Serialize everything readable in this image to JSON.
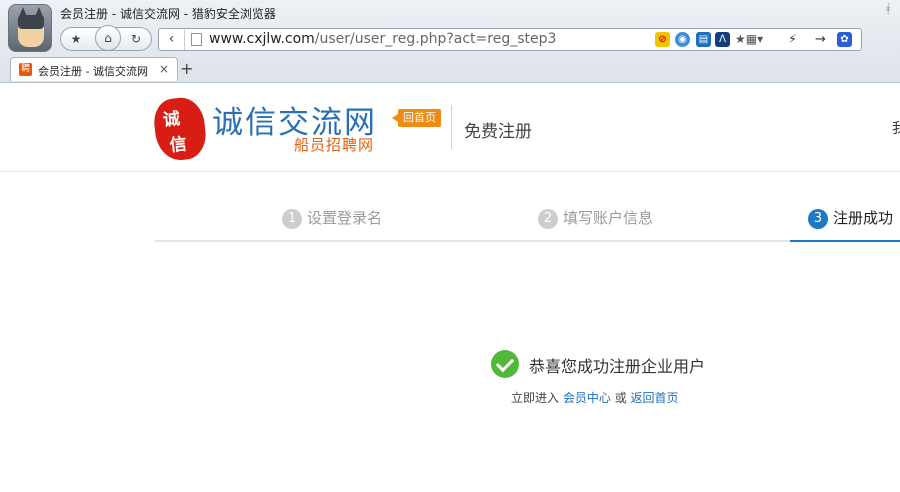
{
  "browser": {
    "window_title": "会员注册 - 诚信交流网 - 猎豹安全浏览器",
    "url_main": "www.cxjlw.com",
    "url_rest": "/user/user_reg.php?act=reg_step3",
    "tab_label": "会员注册 - 诚信交流网",
    "tab_favicon": "聘",
    "new_tab": "+",
    "close_tab": "×"
  },
  "header": {
    "logo_seal": [
      "诚",
      "信"
    ],
    "brand_name": "诚信交流网",
    "brand_sub": "船员招聘网",
    "home_badge": "回首页",
    "page_title": "免费注册",
    "edge_char": "我"
  },
  "steps": [
    {
      "num": "1",
      "label": "设置登录名"
    },
    {
      "num": "2",
      "label": "填写账户信息"
    },
    {
      "num": "3",
      "label": "注册成功"
    }
  ],
  "result": {
    "message": "恭喜您成功注册企业用户",
    "prefix": "立即进入",
    "link_member": "会员中心",
    "conj": "或",
    "link_home": "返回首页"
  },
  "colors": {
    "accent": "#1d78c6",
    "success": "#52b83a",
    "brand_blue": "#2a6fb5",
    "brand_orange": "#e35e0f",
    "seal_red": "#d81e14"
  }
}
